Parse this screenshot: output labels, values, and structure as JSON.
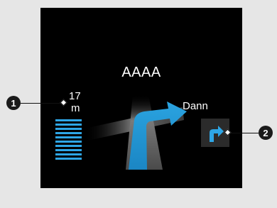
{
  "screen": {
    "title": "AAAA",
    "distance": {
      "value": "17",
      "unit": "m"
    },
    "distance_bars": 10,
    "next_street": "Dann",
    "turn_icon": "turn-right-arrow-icon"
  },
  "callouts": [
    "1",
    "2"
  ],
  "colors": {
    "accent": "#2ea6e6",
    "background": "#000000",
    "road": "#5a5a5a",
    "page": "#e6e6e6"
  }
}
